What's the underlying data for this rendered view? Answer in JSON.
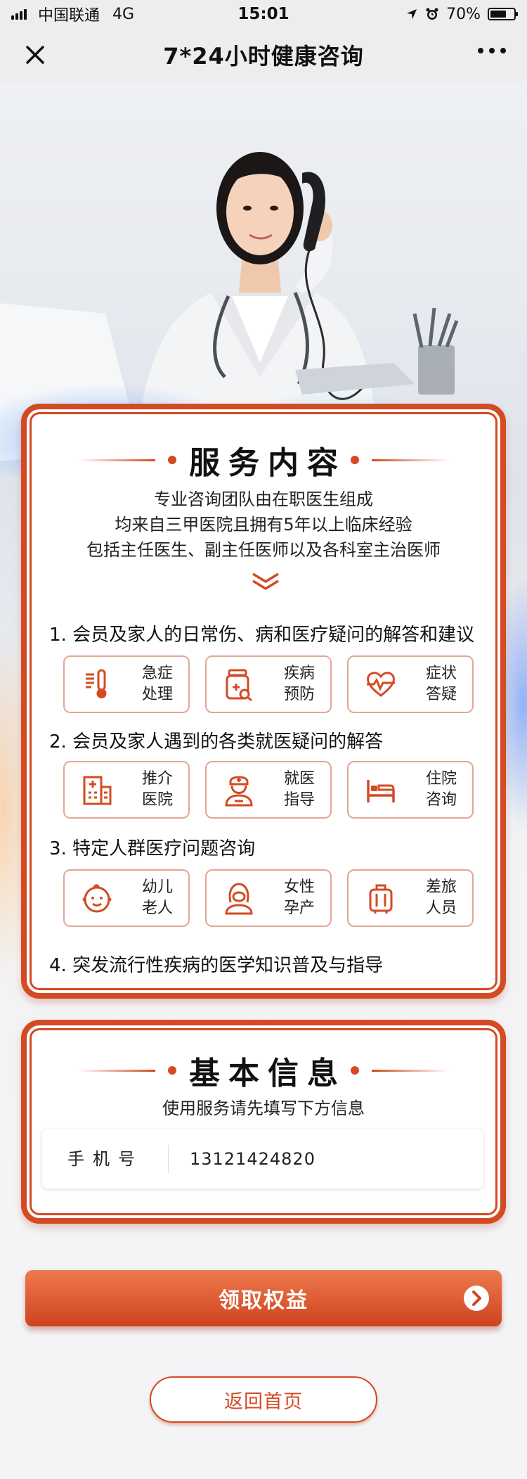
{
  "status_bar": {
    "carrier": "中国联通",
    "network": "4G",
    "time": "15:01",
    "battery": "70%",
    "battery_level": 0.7
  },
  "nav": {
    "title": "7*24小时健康咨询",
    "close_icon": "close-icon",
    "more_icon": "more-icon"
  },
  "service": {
    "title": "服务内容",
    "intro": [
      "专业咨询团队由在职医生组成",
      "均来自三甲医院且拥有5年以上临床经验",
      "包括主任医生、副主任医师以及各科室主治医师"
    ],
    "items": [
      {
        "title": "1. 会员及家人的日常伤、病和医疗疑问的解答和建议",
        "tiles": [
          {
            "label": [
              "急症",
              "处理"
            ],
            "icon": "thermometer-icon"
          },
          {
            "label": [
              "疾病",
              "预防"
            ],
            "icon": "medicine-bottle-icon"
          },
          {
            "label": [
              "症状",
              "答疑"
            ],
            "icon": "heart-pulse-icon"
          }
        ]
      },
      {
        "title": "2. 会员及家人遇到的各类就医疑问的解答",
        "tiles": [
          {
            "label": [
              "推介",
              "医院"
            ],
            "icon": "hospital-icon"
          },
          {
            "label": [
              "就医",
              "指导"
            ],
            "icon": "nurse-icon"
          },
          {
            "label": [
              "住院",
              "咨询"
            ],
            "icon": "bed-icon"
          }
        ]
      },
      {
        "title": "3. 特定人群医疗问题咨询",
        "tiles": [
          {
            "label": [
              "幼儿",
              "老人"
            ],
            "icon": "baby-face-icon"
          },
          {
            "label": [
              "女性",
              "孕产"
            ],
            "icon": "woman-icon"
          },
          {
            "label": [
              "差旅",
              "人员"
            ],
            "icon": "suitcase-icon"
          }
        ]
      },
      {
        "title": "4. 突发流行性疾病的医学知识普及与指导",
        "tiles": []
      }
    ]
  },
  "info": {
    "title": "基本信息",
    "subtitle": "使用服务请先填写下方信息",
    "phone_label": "手机号",
    "phone_value": "13121424820"
  },
  "actions": {
    "claim_label": "领取权益",
    "home_label": "返回首页"
  },
  "colors": {
    "accent": "#d44a22",
    "button_top": "#ee7a4c",
    "button_bottom": "#cf4220"
  }
}
